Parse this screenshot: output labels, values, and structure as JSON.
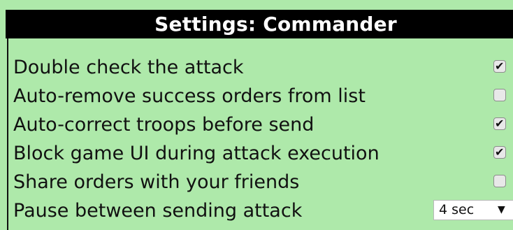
{
  "settings": {
    "title": "Settings: Commander",
    "rows": [
      {
        "label": "Double check the attack",
        "checked": true
      },
      {
        "label": "Auto-remove success orders from list",
        "checked": false
      },
      {
        "label": "Auto-correct troops before send",
        "checked": true
      },
      {
        "label": "Block game UI during attack execution",
        "checked": true
      },
      {
        "label": "Share orders with your friends",
        "checked": false
      }
    ],
    "pause": {
      "label": "Pause between sending attack",
      "value": "4 sec"
    }
  },
  "icons": {
    "check": "check-mark-icon",
    "dropdown": "caret-down-icon"
  },
  "colors": {
    "background": "#aee9aa",
    "header_background": "#000000",
    "header_text": "#ffffff"
  }
}
